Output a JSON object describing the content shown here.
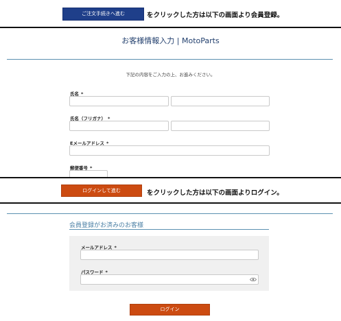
{
  "top_banner": {
    "button_label": "ご注文手続きへ進む",
    "text": "をクリックした方は以下の画面より会員登録。"
  },
  "registration": {
    "title": "お客様情報入力 | MotoParts",
    "intro": "下記の内容をご入力の上、お進みください。",
    "fields": {
      "name_label": "氏名",
      "kana_label": "氏名（フリガナ）",
      "email_label": "Eメールアドレス",
      "postal_label": "郵便番号",
      "required_mark": "*"
    }
  },
  "login_banner": {
    "button_label": "ログインして進む",
    "text": "をクリックした方は以下の画面よりログイン。"
  },
  "login": {
    "heading": "会員登録がお済みのお客様",
    "email_label": "メールアドレス",
    "password_label": "パスワード",
    "required_mark": "*",
    "submit_label": "ログイン"
  },
  "colors": {
    "blue_button": "#1f3f8a",
    "orange_button": "#cc4b11",
    "accent_line": "#5a8fb0",
    "heading_blue": "#4a7fa4"
  },
  "icons": {
    "password_toggle": "eye-icon"
  }
}
